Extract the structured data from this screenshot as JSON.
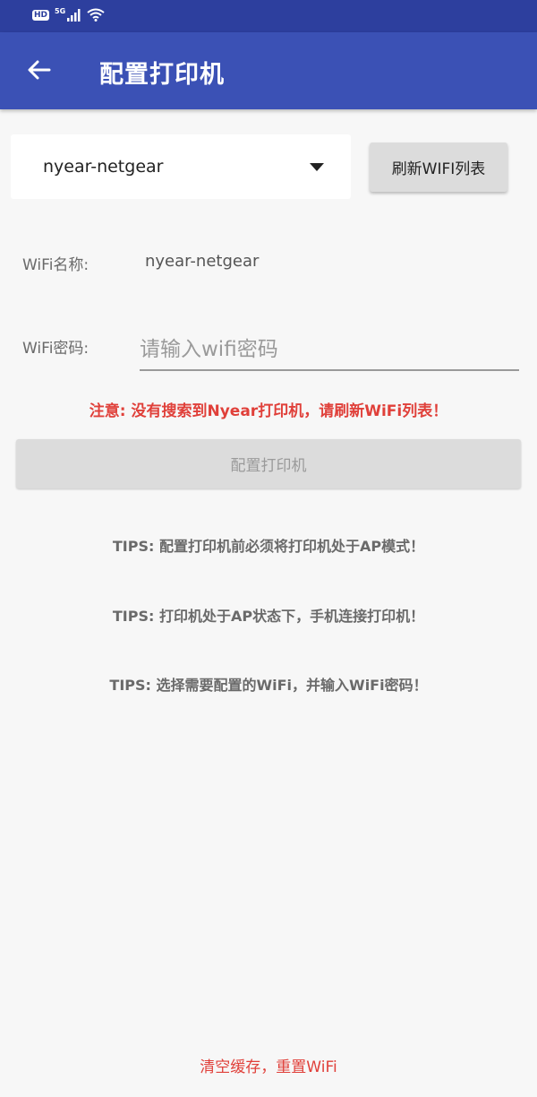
{
  "status_bar": {
    "hd_badge": "HD",
    "network_label": "5G",
    "icons": [
      "hd-badge",
      "signal-icon",
      "wifi-icon"
    ]
  },
  "app_bar": {
    "back_icon": "arrow-left-icon",
    "title": "配置打印机",
    "color": "#3b51b5"
  },
  "wifi_spinner": {
    "selected": "nyear-netgear",
    "icon": "dropdown-caret-icon"
  },
  "refresh_button": {
    "label": "刷新WIFI列表"
  },
  "wifi_name": {
    "label": "WiFi名称:",
    "value": "nyear-netgear"
  },
  "wifi_password": {
    "label": "WiFi密码:",
    "placeholder": "请输入wifi密码",
    "value": ""
  },
  "warning": {
    "text": "注意: 没有搜索到Nyear打印机，请刷新WiFi列表！",
    "color": "#e0403a"
  },
  "config_button": {
    "label": "配置打印机",
    "enabled": false
  },
  "tips": [
    "TIPS: 配置打印机前必须将打印机处于AP模式！",
    "TIPS: 打印机处于AP状态下，手机连接打印机！",
    "TIPS: 选择需要配置的WiFi，并输入WiFi密码！"
  ],
  "reset_link": {
    "label": "清空缓存，重置WiFi",
    "color": "#e0403a"
  }
}
